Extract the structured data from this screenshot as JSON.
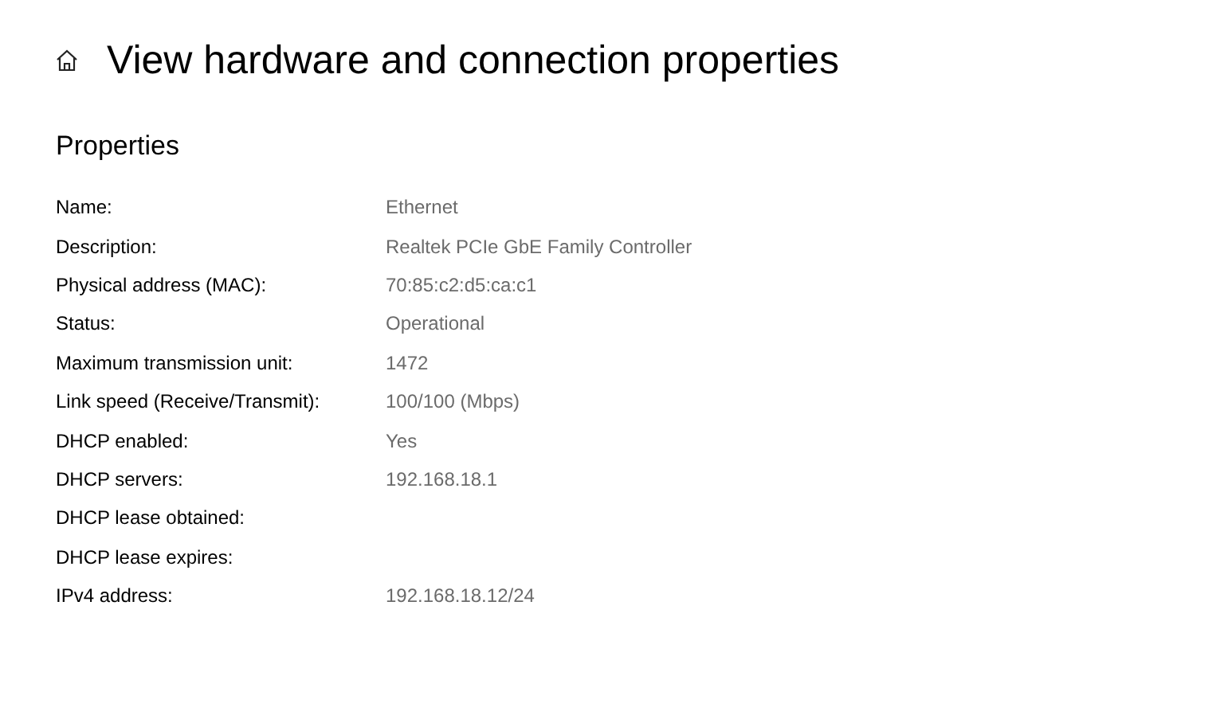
{
  "page": {
    "title": "View hardware and connection properties"
  },
  "section": {
    "heading": "Properties"
  },
  "properties": [
    {
      "label": "Name:",
      "value": "Ethernet"
    },
    {
      "label": "Description:",
      "value": "Realtek PCIe GbE Family Controller"
    },
    {
      "label": "Physical address (MAC):",
      "value": "70:85:c2:d5:ca:c1"
    },
    {
      "label": "Status:",
      "value": "Operational"
    },
    {
      "label": "Maximum transmission unit:",
      "value": "1472"
    },
    {
      "label": "Link speed (Receive/Transmit):",
      "value": "100/100 (Mbps)"
    },
    {
      "label": "DHCP enabled:",
      "value": "Yes"
    },
    {
      "label": "DHCP servers:",
      "value": "192.168.18.1"
    },
    {
      "label": "DHCP lease obtained:"
    },
    {
      "label": "DHCP lease expires:"
    },
    {
      "label": "IPv4 address:",
      "value": "192.168.18.12/24"
    }
  ]
}
